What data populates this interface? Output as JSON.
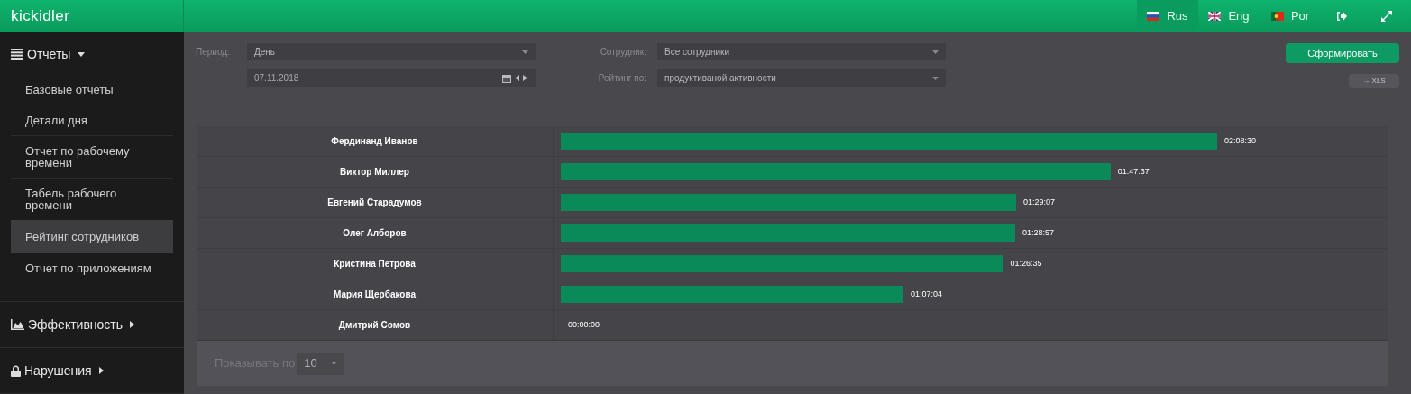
{
  "header": {
    "logo": "kickidler",
    "languages": [
      {
        "label": "Rus",
        "kind": "ru",
        "selected": true
      },
      {
        "label": "Eng",
        "kind": "gb",
        "selected": false
      },
      {
        "label": "Por",
        "kind": "pt",
        "selected": false
      }
    ]
  },
  "sidebar": {
    "sections": [
      {
        "label": "Отчеты",
        "kind": "list",
        "expanded": true,
        "items": [
          {
            "label": "Базовые отчеты",
            "selected": false
          },
          {
            "label": "Детали дня",
            "selected": false
          },
          {
            "label": "Отчет по рабочему времени",
            "selected": false
          },
          {
            "label": "Табель рабочего времени",
            "selected": false
          },
          {
            "label": "Рейтинг сотрудников",
            "selected": true
          },
          {
            "label": "Отчет по приложениям",
            "selected": false
          }
        ]
      },
      {
        "label": "Эффективность",
        "kind": "chart",
        "expanded": false
      },
      {
        "label": "Нарушения",
        "kind": "lock",
        "expanded": false
      }
    ]
  },
  "filters": {
    "period_label": "Период:",
    "period": "День",
    "date": "07.11.2018",
    "employee_label": "Сотрудник:",
    "employee": "Все сотрудники",
    "rating_label": "Рейтинг по:",
    "rating": "продуктиваной активности",
    "submit": "Сформировать",
    "export": "→ XLS"
  },
  "rows": [
    {
      "name": "Фердинанд Иванов",
      "time": "02:08:30"
    },
    {
      "name": "Виктор Миллер",
      "time": "01:47:37"
    },
    {
      "name": "Евгений Старадумов",
      "time": "01:29:07"
    },
    {
      "name": "Олег Алборов",
      "time": "01:28:57"
    },
    {
      "name": "Кристина Петрова",
      "time": "01:26:35"
    },
    {
      "name": "Мария Щербакова",
      "time": "01:07:04"
    },
    {
      "name": "Дмитрий Сомов",
      "time": "00:00:00"
    }
  ],
  "pagination": {
    "label": "Показывать по",
    "value": "10"
  }
}
